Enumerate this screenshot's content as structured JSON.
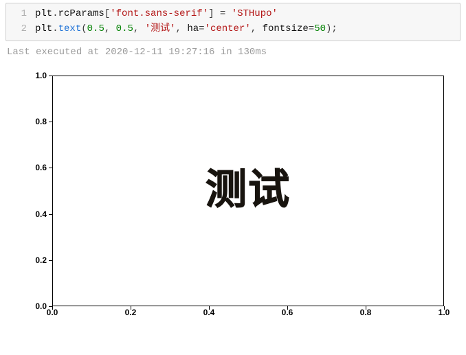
{
  "code": {
    "lines": [
      {
        "n": "1"
      },
      {
        "n": "2"
      }
    ],
    "line1": {
      "obj": "plt",
      "dot1": ".",
      "attr1": "rcParams",
      "lbr": "[",
      "key": "'font.sans-serif'",
      "rbr": "]",
      "sp1": " ",
      "eq": "=",
      "sp2": " ",
      "val": "'STHupo'"
    },
    "line2": {
      "obj": "plt",
      "dot1": ".",
      "fn": "text",
      "lp": "(",
      "x": "0.5",
      "c1": ",",
      "sp1": " ",
      "y": "0.5",
      "c2": ",",
      "sp2": " ",
      "txt": "'测试'",
      "c3": ",",
      "sp3": " ",
      "kw1": "ha",
      "eq1": "=",
      "v1": "'center'",
      "c4": ",",
      "sp4": " ",
      "kw2": "fontsize",
      "eq2": "=",
      "v2": "50",
      "rp": ")",
      "semi": ";"
    }
  },
  "status": "Last executed at 2020-12-11 19:27:16 in 130ms",
  "chart_data": {
    "type": "scatter",
    "title": "",
    "xlabel": "",
    "ylabel": "",
    "xlim": [
      0.0,
      1.0
    ],
    "ylim": [
      0.0,
      1.0
    ],
    "xticks": [
      "0.0",
      "0.2",
      "0.4",
      "0.6",
      "0.8",
      "1.0"
    ],
    "yticks": [
      "0.0",
      "0.2",
      "0.4",
      "0.6",
      "0.8",
      "1.0"
    ],
    "series": [],
    "annotations": [
      {
        "x": 0.5,
        "y": 0.5,
        "text": "测试",
        "ha": "center",
        "fontsize": 50,
        "font": "STHupo"
      }
    ]
  }
}
